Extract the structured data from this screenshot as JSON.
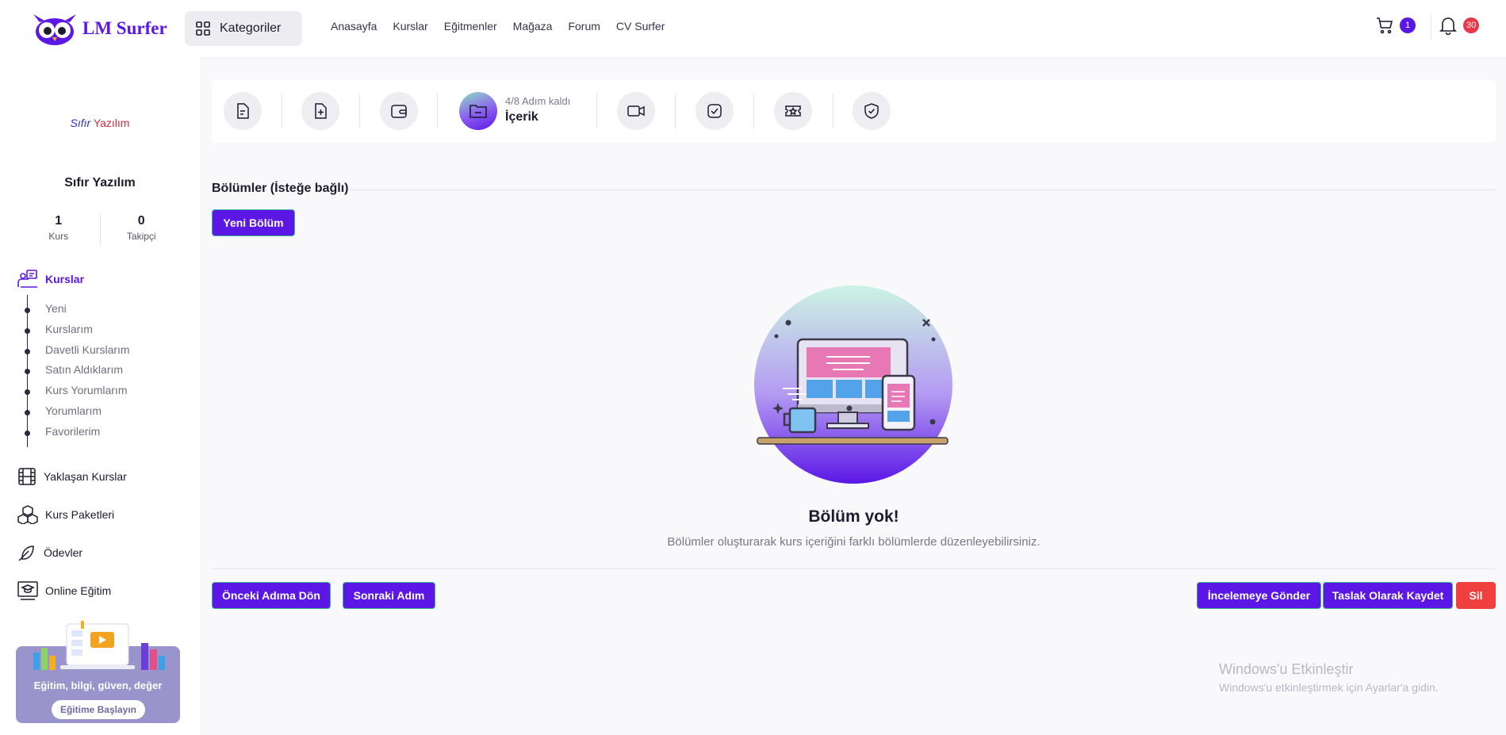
{
  "header": {
    "logo_text": "LM Surfer",
    "categories_label": "Kategoriler",
    "nav": [
      "Anasayfa",
      "Kurslar",
      "Eğitmenler",
      "Mağaza",
      "Forum",
      "CV Surfer"
    ],
    "cart_count": "1",
    "notification_count": "30"
  },
  "sidebar": {
    "brand_logo_part1": "Sıfır",
    "brand_logo_part2": "Yazılım",
    "profile_name": "Sıfır Yazılım",
    "stats": [
      {
        "value": "1",
        "label": "Kurs"
      },
      {
        "value": "0",
        "label": "Takipçi"
      }
    ],
    "courses_label": "Kurslar",
    "course_sub_items": [
      "Yeni",
      "Kurslarım",
      "Davetli Kurslarım",
      "Satın Aldıklarım",
      "Kurs Yorumlarım",
      "Yorumlarım",
      "Favorilerim"
    ],
    "menu_items": [
      "Yaklaşan Kurslar",
      "Kurs Paketleri",
      "Ödevler",
      "Online Eğitim"
    ],
    "promo_title": "Eğitim, bilgi, güven, değer",
    "promo_button": "Eğitime Başlayın"
  },
  "steps": {
    "progress_text": "4/8 Adım kaldı",
    "active_step": "İçerik"
  },
  "content": {
    "section_title": "Bölümler (İsteğe bağlı)",
    "new_section_button": "Yeni Bölüm",
    "empty_title": "Bölüm yok!",
    "empty_subtitle": "Bölümler oluşturarak kurs içeriğini farklı bölümlerde düzenleyebilirsiniz."
  },
  "actions": {
    "prev": "Önceki Adıma Dön",
    "next": "Sonraki Adım",
    "submit_review": "İncelemeye Gönder",
    "save_draft": "Taslak Olarak Kaydet",
    "delete": "Sil"
  },
  "watermark": {
    "line1": "Windows'u Etkinleştir",
    "line2": "Windows'u etkinleştirmek için Ayarlar'a gidin."
  },
  "colors": {
    "accent": "#5b17e6",
    "danger": "#ef3f3f",
    "badge_red": "#e8394a"
  }
}
